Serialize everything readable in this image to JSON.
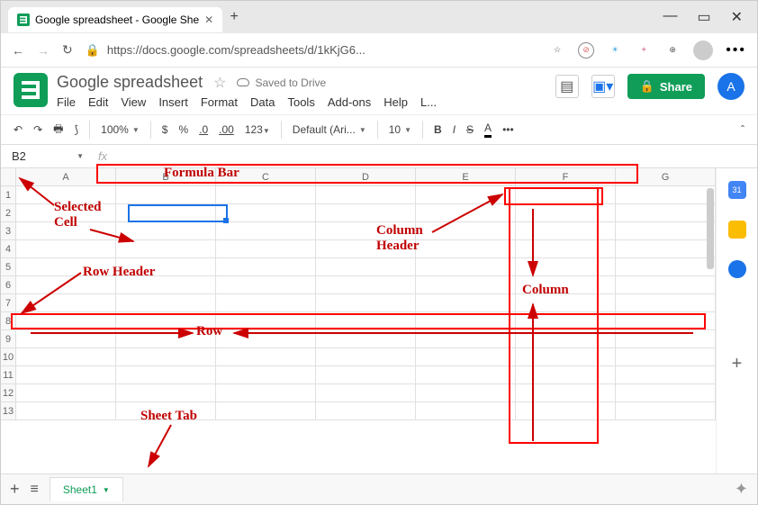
{
  "browser": {
    "tab_title": "Google spreadsheet - Google She",
    "url": "https://docs.google.com/spreadsheets/d/1kKjG6...",
    "minimize": "—",
    "maximize": "▭",
    "close": "✕"
  },
  "doc": {
    "title": "Google spreadsheet",
    "saved": "Saved to Drive",
    "menu": [
      "File",
      "Edit",
      "View",
      "Insert",
      "Format",
      "Data",
      "Tools",
      "Add-ons",
      "Help",
      "L..."
    ],
    "share": "Share",
    "avatar_letter": "A"
  },
  "toolbar": {
    "zoom": "100%",
    "currency": "$",
    "percent": "%",
    "dec0": ".0",
    "dec00": ".00",
    "numfmt": "123",
    "font": "Default (Ari...",
    "fontsize": "10",
    "bold": "B",
    "italic": "I",
    "strike": "S",
    "color": "A",
    "more": "•••",
    "chev": "ˆ"
  },
  "formula_bar": {
    "namebox": "B2",
    "fx": "fx"
  },
  "grid": {
    "cols": [
      "A",
      "B",
      "C",
      "D",
      "E",
      "F",
      "G"
    ],
    "rows": [
      "1",
      "2",
      "3",
      "4",
      "5",
      "6",
      "7",
      "8",
      "9",
      "10",
      "11",
      "12",
      "13"
    ]
  },
  "bottom": {
    "plus": "+",
    "menu": "≡",
    "sheet": "Sheet1"
  },
  "annotations": {
    "formula_bar": "Formula Bar",
    "selected_cell": "Selected\nCell",
    "row_header": "Row Header",
    "column_header": "Column\nHeader",
    "column": "Column",
    "row": "Row",
    "sheet_tab": "Sheet Tab"
  },
  "sidepanel": {
    "calendar_day": "31"
  }
}
